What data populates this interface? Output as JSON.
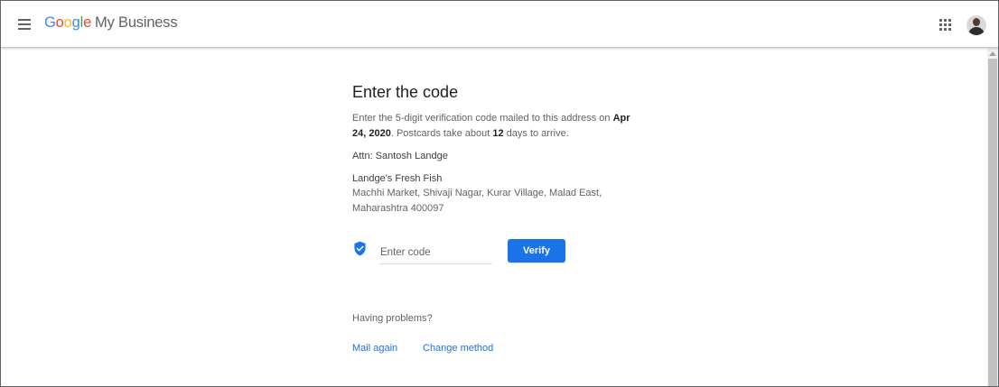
{
  "header": {
    "logo": {
      "brand_letters": [
        "G",
        "o",
        "o",
        "g",
        "l",
        "e"
      ],
      "product": "My Business"
    },
    "menu_icon": "hamburger-menu-icon",
    "apps_icon": "apps-grid-icon",
    "avatar_icon": "user-avatar"
  },
  "colors": {
    "accent": "#1a73e8",
    "google_blue": "#4285f4",
    "google_red": "#ea4335",
    "google_yellow": "#fbbc05",
    "google_green": "#34a853"
  },
  "main": {
    "title": "Enter the code",
    "description": {
      "prefix": "Enter the 5-digit verification code mailed to this address on",
      "date": "Apr 24, 2020",
      "middle": ". Postcards take about",
      "days": "12",
      "suffix": "days to arrive."
    },
    "attn": "Attn: Santosh Landge",
    "business_name": "Landge's Fresh Fish",
    "address_line1": "Machhi Market, Shivaji Nagar, Kurar Village, Malad East,",
    "address_line2": "Maharashtra 400097",
    "code_input": {
      "placeholder": "Enter code",
      "value": "",
      "icon": "verified-shield-icon"
    },
    "verify_label": "Verify",
    "problems_heading": "Having problems?",
    "links": {
      "mail_again": "Mail again",
      "change_method": "Change method"
    }
  }
}
